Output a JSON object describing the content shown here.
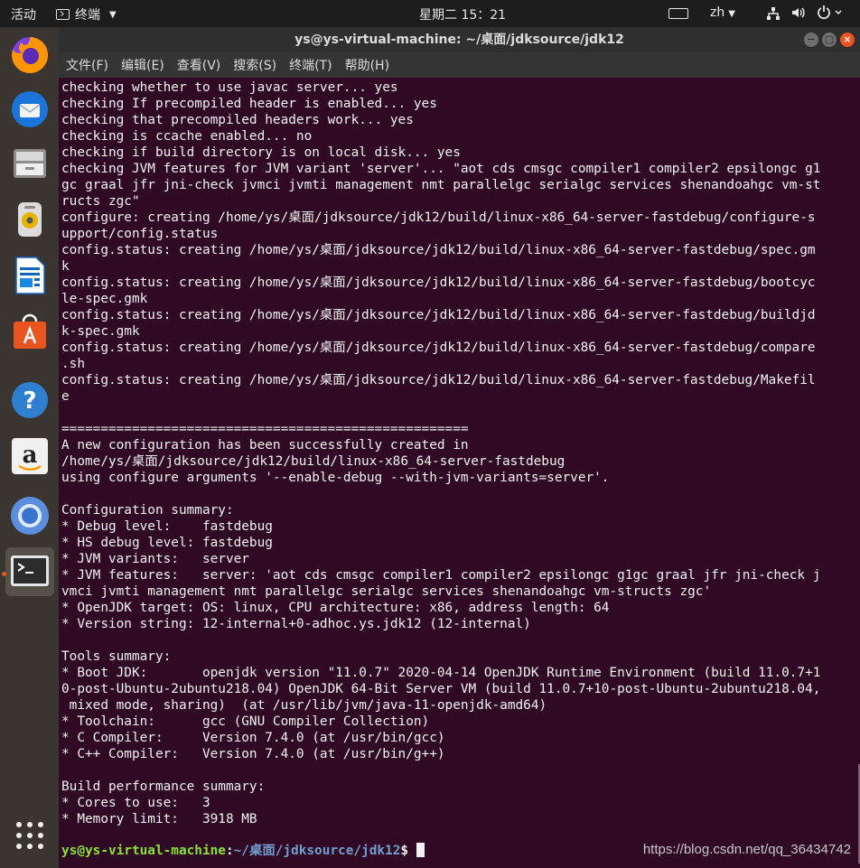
{
  "topbar": {
    "activities": "活动",
    "app_name": "终端",
    "clock": "星期二 15：21",
    "language": "zh"
  },
  "window": {
    "title": "ys@ys-virtual-machine: ~/桌面/jdksource/jdk12",
    "controls": [
      "−",
      "▢",
      "×"
    ]
  },
  "menu": [
    "文件(F)",
    "编辑(E)",
    "查看(V)",
    "搜索(S)",
    "终端(T)",
    "帮助(H)"
  ],
  "dock": [
    {
      "name": "firefox-icon",
      "active": false
    },
    {
      "name": "thunderbird-icon",
      "active": false
    },
    {
      "name": "files-icon",
      "active": false
    },
    {
      "name": "rhythmbox-icon",
      "active": false
    },
    {
      "name": "libreoffice-writer-icon",
      "active": false
    },
    {
      "name": "software-center-icon",
      "active": false
    },
    {
      "name": "help-icon",
      "active": false
    },
    {
      "name": "amazon-icon",
      "active": false
    },
    {
      "name": "chromium-icon",
      "active": false
    },
    {
      "name": "terminal-icon",
      "active": true
    },
    {
      "name": "show-apps-icon",
      "active": false
    }
  ],
  "terminal": {
    "lines": [
      "checking whether to use javac server... yes",
      "checking If precompiled header is enabled... yes",
      "checking that precompiled headers work... yes",
      "checking is ccache enabled... no",
      "checking if build directory is on local disk... yes",
      "checking JVM features for JVM variant 'server'... \"aot cds cmsgc compiler1 compiler2 epsilongc g1",
      "gc graal jfr jni-check jvmci jvmti management nmt parallelgc serialgc services shenandoahgc vm-st",
      "ructs zgc\"",
      "configure: creating /home/ys/桌面/jdksource/jdk12/build/linux-x86_64-server-fastdebug/configure-s",
      "upport/config.status",
      "config.status: creating /home/ys/桌面/jdksource/jdk12/build/linux-x86_64-server-fastdebug/spec.gm",
      "k",
      "config.status: creating /home/ys/桌面/jdksource/jdk12/build/linux-x86_64-server-fastdebug/bootcyc",
      "le-spec.gmk",
      "config.status: creating /home/ys/桌面/jdksource/jdk12/build/linux-x86_64-server-fastdebug/buildjd",
      "k-spec.gmk",
      "config.status: creating /home/ys/桌面/jdksource/jdk12/build/linux-x86_64-server-fastdebug/compare",
      ".sh",
      "config.status: creating /home/ys/桌面/jdksource/jdk12/build/linux-x86_64-server-fastdebug/Makefil",
      "e",
      "",
      "====================================================",
      "A new configuration has been successfully created in",
      "/home/ys/桌面/jdksource/jdk12/build/linux-x86_64-server-fastdebug",
      "using configure arguments '--enable-debug --with-jvm-variants=server'.",
      "",
      "Configuration summary:",
      "* Debug level:    fastdebug",
      "* HS debug level: fastdebug",
      "* JVM variants:   server",
      "* JVM features:   server: 'aot cds cmsgc compiler1 compiler2 epsilongc g1gc graal jfr jni-check j",
      "vmci jvmti management nmt parallelgc serialgc services shenandoahgc vm-structs zgc'",
      "* OpenJDK target: OS: linux, CPU architecture: x86, address length: 64",
      "* Version string: 12-internal+0-adhoc.ys.jdk12 (12-internal)",
      "",
      "Tools summary:",
      "* Boot JDK:       openjdk version \"11.0.7\" 2020-04-14 OpenJDK Runtime Environment (build 11.0.7+1",
      "0-post-Ubuntu-2ubuntu218.04) OpenJDK 64-Bit Server VM (build 11.0.7+10-post-Ubuntu-2ubuntu218.04,",
      " mixed mode, sharing)  (at /usr/lib/jvm/java-11-openjdk-amd64)",
      "* Toolchain:      gcc (GNU Compiler Collection)",
      "* C Compiler:     Version 7.4.0 (at /usr/bin/gcc)",
      "* C++ Compiler:   Version 7.4.0 (at /usr/bin/g++)",
      "",
      "Build performance summary:",
      "* Cores to use:   3",
      "* Memory limit:   3918 MB"
    ],
    "prompt_user": "ys@ys-virtual-machine",
    "prompt_sep": ":",
    "prompt_path": "~/桌面/jdksource/jdk12",
    "prompt_symbol": "$ ",
    "watermark": "https://blog.csdn.net/qq_36434742"
  },
  "colors": {
    "terminal_bg": "#300a24",
    "prompt_user": "#8ae234",
    "prompt_path": "#729fcf",
    "accent": "#e95420"
  }
}
